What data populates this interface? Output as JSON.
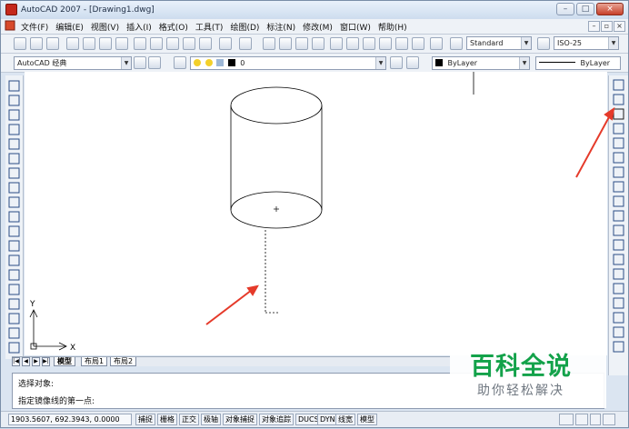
{
  "window": {
    "title": "AutoCAD 2007 - [Drawing1.dwg]",
    "controls": [
      "–",
      "□",
      "×"
    ],
    "doc_controls": [
      "–",
      "▫",
      "×"
    ]
  },
  "menu": [
    "文件(F)",
    "编辑(E)",
    "视图(V)",
    "插入(I)",
    "格式(O)",
    "工具(T)",
    "绘图(D)",
    "标注(N)",
    "修改(M)",
    "窗口(W)",
    "帮助(H)"
  ],
  "toolbar1": {
    "text_style": "Standard",
    "dim_style": "ISO-25"
  },
  "toolbar2": {
    "workspace": "AutoCAD 经典",
    "layer": "0",
    "color": "ByLayer",
    "linetype": "ByLayer"
  },
  "layout_tabs": {
    "nav": [
      "|◀",
      "◀",
      "▶",
      "▶|"
    ],
    "tabs": [
      "模型",
      "布局1",
      "布局2"
    ]
  },
  "ucs": {
    "x_label": "X",
    "y_label": "Y"
  },
  "command": {
    "line1": "选择对象:",
    "line2": "指定镜像线的第一点:"
  },
  "status": {
    "coords": "1903.5607, 692.3943, 0.0000",
    "toggles": [
      "捕捉",
      "栅格",
      "正交",
      "极轴",
      "对象捕捉",
      "对象追踪",
      "DUCS",
      "DYN",
      "线宽",
      "模型"
    ]
  },
  "watermark": {
    "main": "百科全说",
    "sub": "助你轻松解决"
  },
  "colors": {
    "annotation_arrow": "#e53a2a",
    "watermark_green": "#13a24a",
    "color_swatch": "#000000"
  }
}
